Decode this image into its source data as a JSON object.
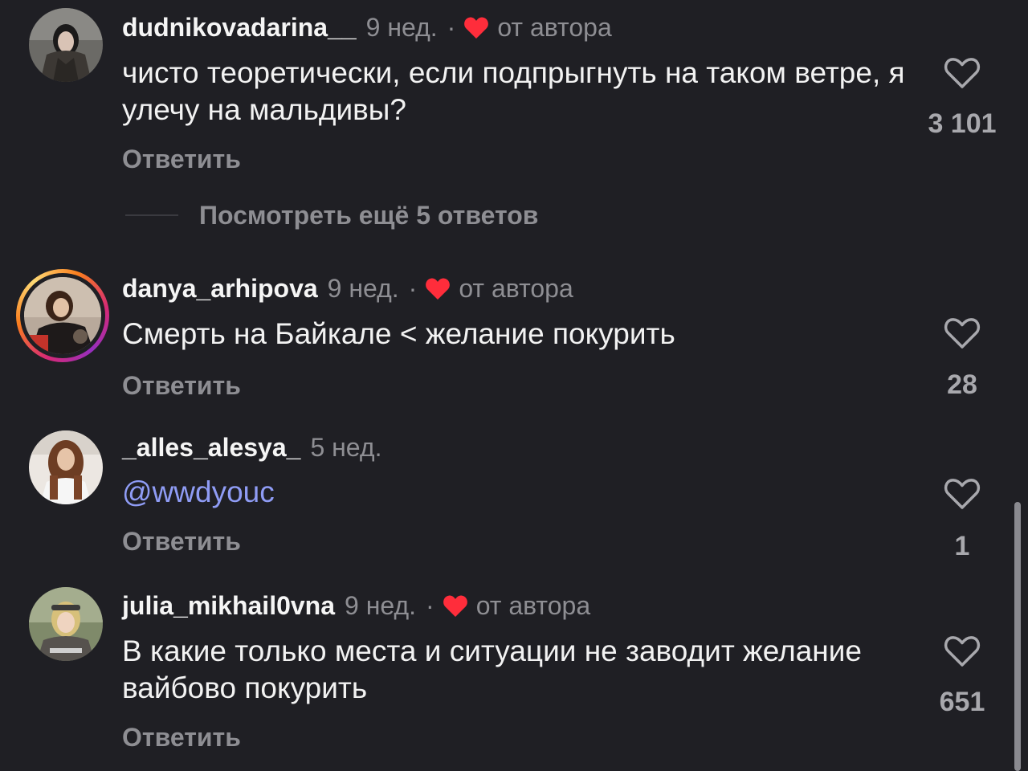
{
  "comments": [
    {
      "username": "dudnikovadarina__",
      "time": "9 нед.",
      "dot": "·",
      "author_label": "от автора",
      "text": "чисто теоретически, если подпрыгнуть на таком ветре, я улечу на мальдивы?",
      "reply_label": "Ответить",
      "likes": "3 101",
      "liked_by_author": true
    },
    {
      "username": "danya_arhipova",
      "time": "9 нед.",
      "dot": "·",
      "author_label": "от автора",
      "text": "Смерть на Байкале < желание покурить",
      "reply_label": "Ответить",
      "likes": "28",
      "liked_by_author": true,
      "has_story_ring": true
    },
    {
      "username": "_alles_alesya_",
      "time": "5 нед.",
      "text": "@wwdyouc",
      "reply_label": "Ответить",
      "likes": "1",
      "liked_by_author": false
    },
    {
      "username": "julia_mikhail0vna",
      "time": "9 нед.",
      "dot": "·",
      "author_label": "от автора",
      "text": "В какие только места и ситуации не заводит желание вайбово покурить",
      "reply_label": "Ответить",
      "likes": "651",
      "liked_by_author": true
    }
  ],
  "view_more_replies": "Посмотреть ещё 5 ответов",
  "colors": {
    "background": "#1f1f24",
    "author_heart": "#ff2d3b",
    "mention": "#8f9cf5",
    "muted": "#8e8e93"
  },
  "icons": {
    "like": "heart-outline-icon",
    "author_like": "heart-filled-icon"
  }
}
